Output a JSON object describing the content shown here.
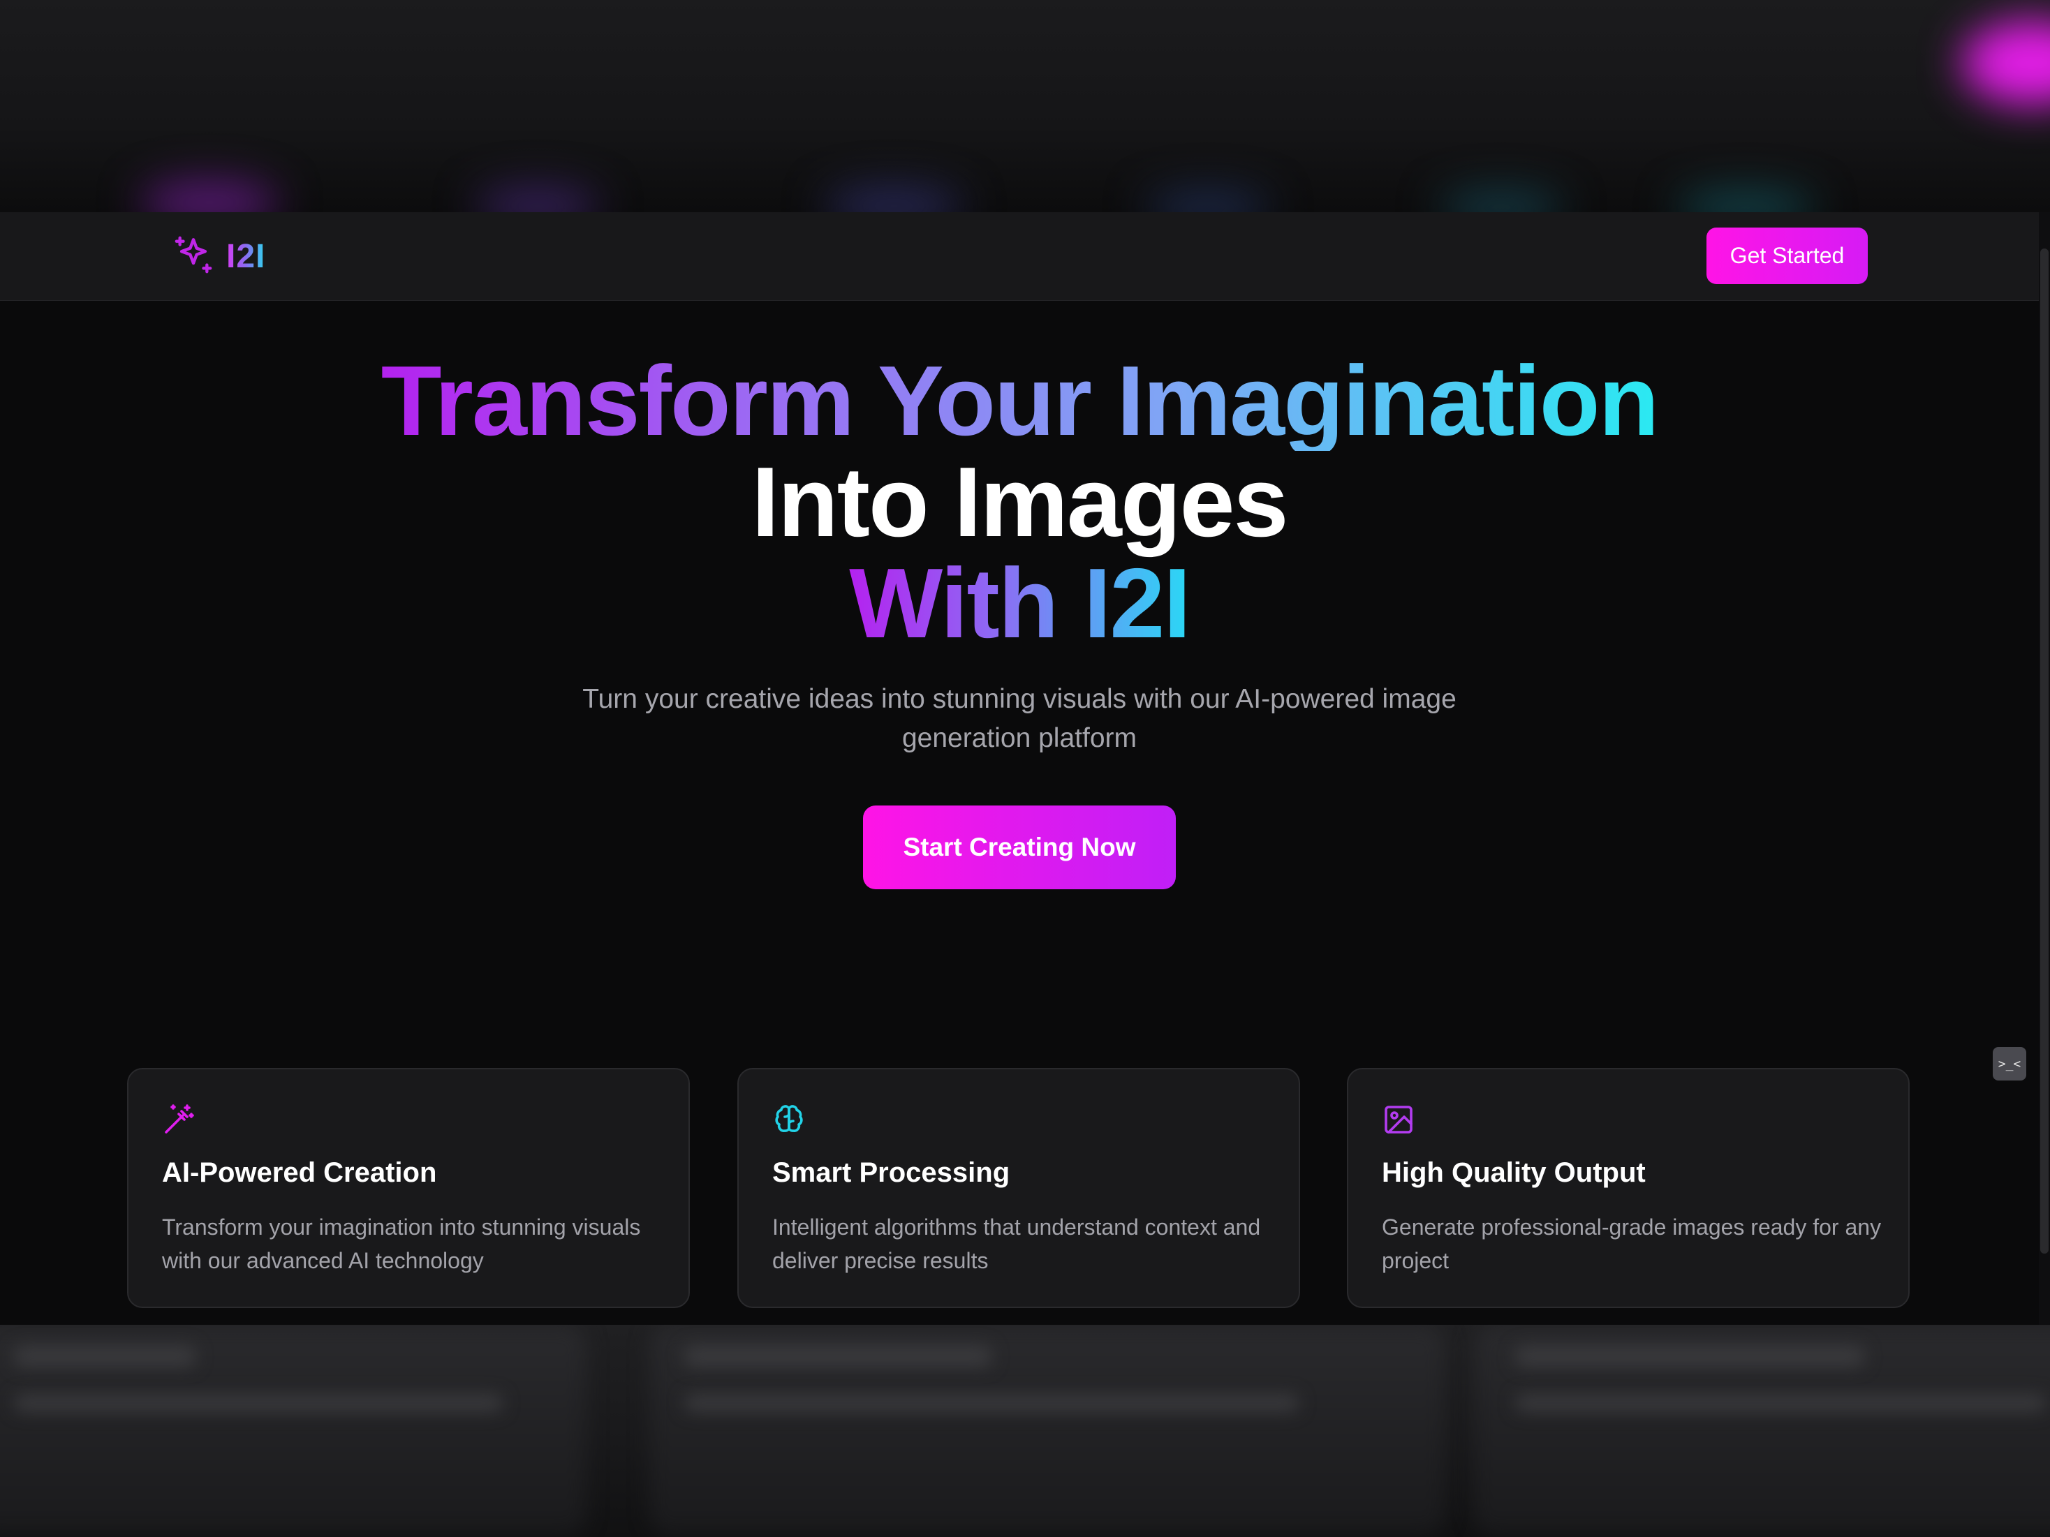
{
  "navbar": {
    "logo_text": "I2I",
    "logo_icon": "sparkles-icon",
    "get_started_label": "Get Started"
  },
  "hero": {
    "title_line1": "Transform Your Imagination",
    "title_line2": "Into Images",
    "title_line3": "With I2I",
    "subtitle": "Turn your creative ideas into stunning visuals with our AI-powered image generation platform",
    "cta_label": "Start Creating Now"
  },
  "features": [
    {
      "icon": "magic-wand-icon",
      "title": "AI-Powered Creation",
      "description": "Transform your imagination into stunning visuals with our advanced AI technology"
    },
    {
      "icon": "brain-icon",
      "title": "Smart Processing",
      "description": "Intelligent algorithms that understand context and deliver precise results"
    },
    {
      "icon": "image-icon",
      "title": "High Quality Output",
      "description": "Generate professional-grade images ready for any project"
    }
  ],
  "side_widget": {
    "label": ">_<"
  },
  "colors": {
    "accent_magenta": "#ff14e6",
    "accent_purple": "#b422ef",
    "accent_cyan": "#2ae9f2",
    "background": "#0a0a0b",
    "card_bg": "#19191b"
  }
}
